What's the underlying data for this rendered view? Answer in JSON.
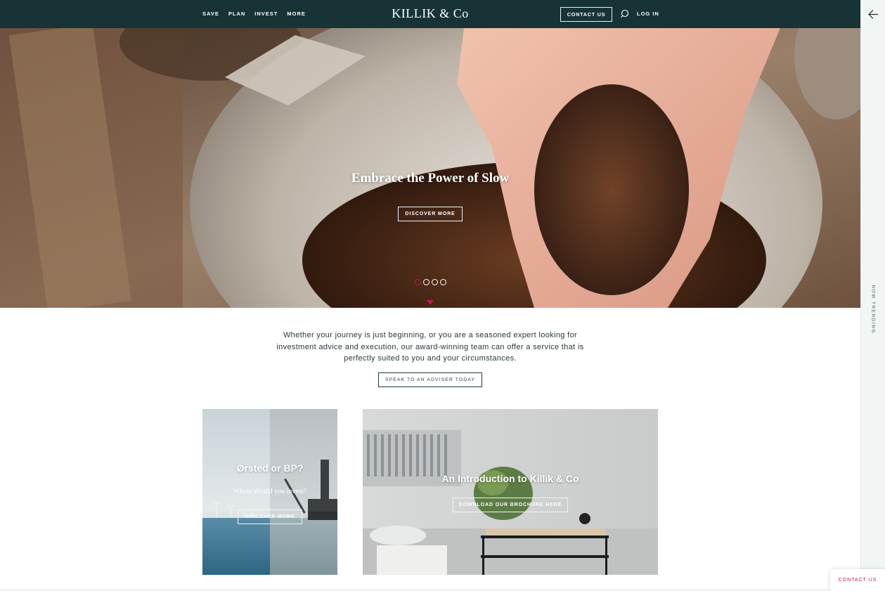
{
  "header": {
    "nav": [
      "SAVE",
      "PLAN",
      "INVEST",
      "MORE"
    ],
    "logo": "KILLIK & Co",
    "contact": "CONTACT US",
    "login": "LOG IN"
  },
  "side_panel": {
    "trending": "NOW TRENDING"
  },
  "hero": {
    "title": "Embrace the Power of Slow",
    "button": "DISCOVER MORE",
    "slide_count": 4,
    "active_slide": 1
  },
  "intro": {
    "text": "Whether your journey is just beginning, or you are a seasoned expert looking for investment advice and execution, our award-winning team can offer a service that is perfectly suited to you and your circumstances.",
    "button": "SPEAK TO AN ADVISER TODAY"
  },
  "cards": [
    {
      "title": "Ørsted or BP?",
      "subtitle": "Where should you invest?",
      "button": "DISCOVER MORE"
    },
    {
      "title": "An Introduction to Killik & Co",
      "button": "DOWNLOAD OUR BROCHURE HERE"
    }
  ],
  "floating": {
    "contact": "CONTACT US"
  },
  "colors": {
    "header_bg": "#173336",
    "accent": "#c2185b",
    "panel_bg": "#f1f6f5"
  },
  "icons": [
    "search-icon",
    "back-arrow-icon",
    "scroll-down-arrow-icon"
  ]
}
